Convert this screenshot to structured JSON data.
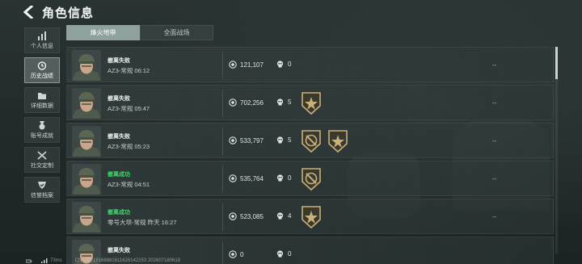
{
  "header": {
    "title": "角色信息"
  },
  "sidebar": {
    "items": [
      {
        "label": "个人信息",
        "icon": "bar-chart-icon",
        "active": false
      },
      {
        "label": "历史战绩",
        "icon": "clock-icon",
        "active": true
      },
      {
        "label": "详细数据",
        "icon": "folder-icon",
        "active": false
      },
      {
        "label": "账号成就",
        "icon": "medal-icon",
        "active": false
      },
      {
        "label": "社交定制",
        "icon": "tools-icon",
        "active": false
      },
      {
        "label": "信誉档案",
        "icon": "shield-check-icon",
        "active": false
      }
    ]
  },
  "tabs": [
    {
      "label": "烽火地带",
      "active": true
    },
    {
      "label": "全面战场",
      "active": false
    }
  ],
  "matches": [
    {
      "result": "撤离失败",
      "success": false,
      "mode": "AZ3-常规 06:12",
      "value": "121,107",
      "kills": "0",
      "badges": [],
      "extra": "--"
    },
    {
      "result": "撤离失败",
      "success": false,
      "mode": "AZ3-常规 05:47",
      "value": "702,256",
      "kills": "5",
      "badges": [
        "star-badge"
      ],
      "extra": "--"
    },
    {
      "result": "撤离失败",
      "success": false,
      "mode": "AZ3-常规 05:23",
      "value": "533,797",
      "kills": "5",
      "badges": [
        "slash-badge",
        "star-badge"
      ],
      "extra": "--"
    },
    {
      "result": "撤离成功",
      "success": true,
      "mode": "AZ3-常规 04:51",
      "value": "535,764",
      "kills": "0",
      "badges": [
        "slash-badge"
      ],
      "extra": "--"
    },
    {
      "result": "撤离成功",
      "success": true,
      "mode": "零号大坝-常规 昨天 16:27",
      "value": "523,085",
      "kills": "4",
      "badges": [
        "star-badge"
      ],
      "extra": "--"
    },
    {
      "result": "撤离失败",
      "success": false,
      "mode": "",
      "value": "0",
      "kills": "0",
      "badges": [],
      "extra": ""
    }
  ],
  "footer": {
    "latency": "73ms",
    "cn_id": "CN UID:18168881611626142253 202607180618"
  },
  "colors": {
    "success": "#3ed96b",
    "tab_active": "#8fa19c",
    "badge_gold": "#c9b07a"
  }
}
